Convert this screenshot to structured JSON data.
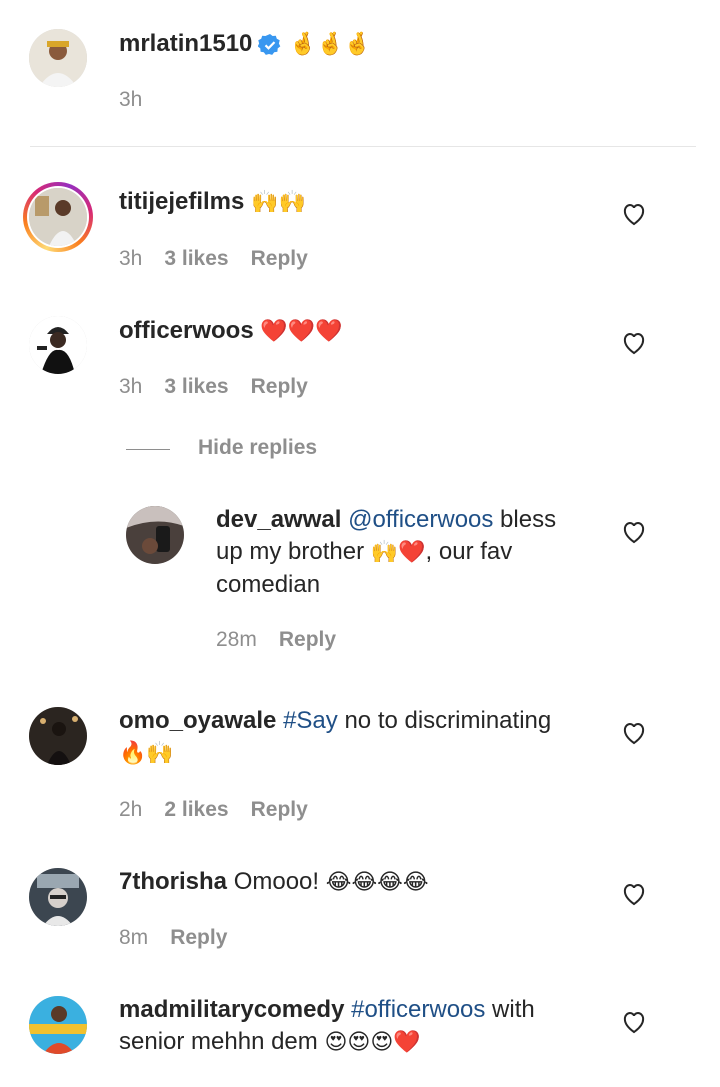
{
  "pinned": {
    "username": "mrlatin1510",
    "text_emoji": "🤞🤞🤞",
    "time": "3h"
  },
  "comments": [
    {
      "username": "titijejefilms",
      "text": "",
      "emoji": "🙌🙌",
      "time": "3h",
      "likes": "3 likes",
      "reply": "Reply"
    },
    {
      "username": "officerwoos",
      "text": "",
      "emoji": "❤️❤️❤️",
      "time": "3h",
      "likes": "3 likes",
      "reply": "Reply",
      "hide_replies": "Hide replies"
    },
    {
      "username": "dev_awwal",
      "mention": "@officerwoos",
      "text1": " bless",
      "text2": "up my brother",
      "emoji2": "🙌❤️",
      "text2b": ", our fav",
      "text3": "comedian",
      "time": "28m",
      "reply": "Reply"
    },
    {
      "username": "omo_oyawale",
      "mention": "#Say",
      "text1": " no to discriminating",
      "emoji2": "🔥🙌",
      "time": "2h",
      "likes": "2 likes",
      "reply": "Reply"
    },
    {
      "username": "7thorisha",
      "text1": " Omooo!",
      "emoji": "😂😂😂😂",
      "time": "8m",
      "reply": "Reply"
    },
    {
      "username": "madmilitarycomedy",
      "mention": "#officerwoos",
      "text1": " with",
      "text2": "senior mehhn dem",
      "emoji2": "😍😍😍❤️"
    }
  ],
  "colors": {
    "mention": "#1f4f86",
    "meta": "#8e8e8e",
    "verified": "#3897f0",
    "heart_red": "#e0202c"
  }
}
